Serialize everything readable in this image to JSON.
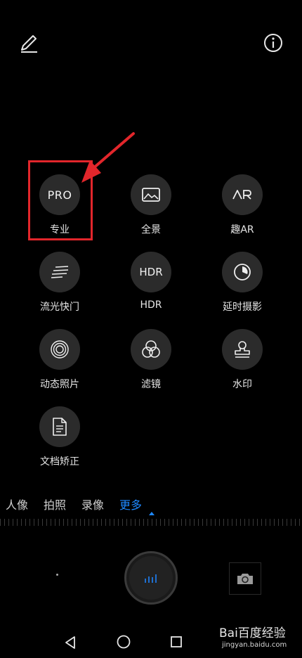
{
  "topbar": {
    "edit_icon": "pencil-icon",
    "info_icon": "info-icon"
  },
  "modes": [
    {
      "key": "pro",
      "icon_text": "PRO",
      "label": "专业"
    },
    {
      "key": "panorama",
      "icon": "panorama-icon",
      "label": "全景"
    },
    {
      "key": "fun-ar",
      "icon_text": "AR",
      "label": "趣AR"
    },
    {
      "key": "light-painting",
      "icon": "light-streak-icon",
      "label": "流光快门"
    },
    {
      "key": "hdr",
      "icon_text": "HDR",
      "label": "HDR"
    },
    {
      "key": "time-lapse",
      "icon": "time-lapse-icon",
      "label": "延时摄影"
    },
    {
      "key": "moving-picture",
      "icon": "moving-picture-icon",
      "label": "动态照片"
    },
    {
      "key": "filter",
      "icon": "filter-icon",
      "label": "滤镜"
    },
    {
      "key": "watermark",
      "icon": "stamp-icon",
      "label": "水印"
    },
    {
      "key": "document-scan",
      "icon": "document-icon",
      "label": "文档矫正"
    }
  ],
  "tabs": {
    "portrait": "人像",
    "photo": "拍照",
    "video": "录像",
    "more": "更多",
    "active": "more"
  },
  "colors": {
    "accent": "#1e88ff",
    "highlight_box": "#e2262b",
    "icon_bg": "#2b2b2b"
  },
  "watermark": {
    "logo": "Bai百度经验",
    "site": "jingyan.baidu.com"
  }
}
